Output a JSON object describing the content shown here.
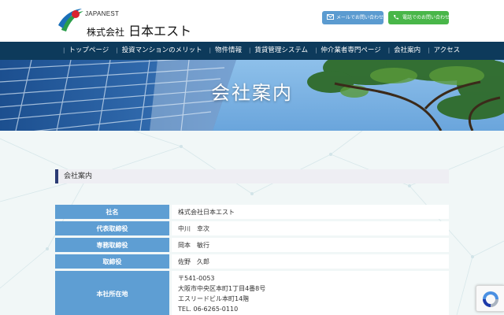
{
  "header": {
    "logo_en": "JAPANEST",
    "logo_jp_small": "株式会社",
    "logo_jp_large": "日本エスト",
    "mail_button": "メールでお問い合わせ",
    "tel_button": "電話でのお問い合わせ",
    "colors": {
      "mail": "#5b9bd0",
      "tel": "#49b649"
    }
  },
  "nav": {
    "items": [
      {
        "label": "トップページ"
      },
      {
        "label": "投資マンションのメリット"
      },
      {
        "label": "物件情報"
      },
      {
        "label": "賃貸管理システム"
      },
      {
        "label": "仲介業者専門ページ"
      },
      {
        "label": "会社案内"
      },
      {
        "label": "アクセス"
      }
    ],
    "background": "#0d3a5b"
  },
  "hero": {
    "title": "会社案内"
  },
  "section": {
    "title": "会社案内"
  },
  "company_table": {
    "rows": [
      {
        "label": "社名",
        "value": "株式会社日本エスト"
      },
      {
        "label": "代表取締役",
        "value": "中川　幸次"
      },
      {
        "label": "専務取締役",
        "value": "岡本　敏行"
      },
      {
        "label": "取締役",
        "value": "佐野　久郎"
      },
      {
        "label": "本社所在地",
        "lines": [
          "〒541-0053",
          "大阪市中央区本町1丁目4番8号",
          "エスリードビル本町14階",
          "TEL. 06-6265-0110"
        ]
      }
    ]
  }
}
